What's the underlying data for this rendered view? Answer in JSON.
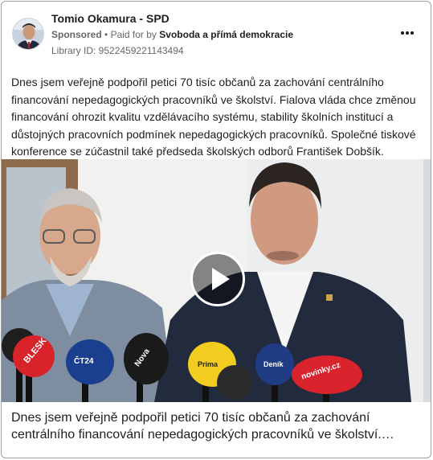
{
  "post": {
    "page_name": "Tomio Okamura - SPD",
    "sponsored": "Sponsored",
    "separator": "•",
    "paid_for_by_prefix": "Paid for by",
    "paid_for_by": "Svoboda a přímá demokracie",
    "library_id": "Library ID: 9522459221143494",
    "more_icon": "more-horizontal-icon",
    "body_text": "Dnes jsem veřejně podpořil petici 70 tisíc občanů za zachování centrálního financování nepedagogických pracovníků ve školství. Fialova vláda chce změnou financování ohrozit kvalitu vzdělávacího systému, stability školních institucí a důstojných pracovních podmínek nepedagogických pracovníků. Společné tiskové konference se zúčastnil také předseda školských odborů František Dobšík.",
    "media": {
      "play_icon": "play-icon",
      "mic_labels": [
        "BLESK",
        "ČT24",
        "Nova",
        "novinky.cz",
        "Prima",
        "Deník"
      ]
    },
    "link_title": "Dnes jsem veřejně podpořil petici 70 tisíc občanů za zachování centrálního financování nepedagogických pracovníků ve školství.…"
  },
  "colors": {
    "text_primary": "#1c1e21",
    "text_secondary": "#65676b",
    "border": "#9aa0a6"
  }
}
